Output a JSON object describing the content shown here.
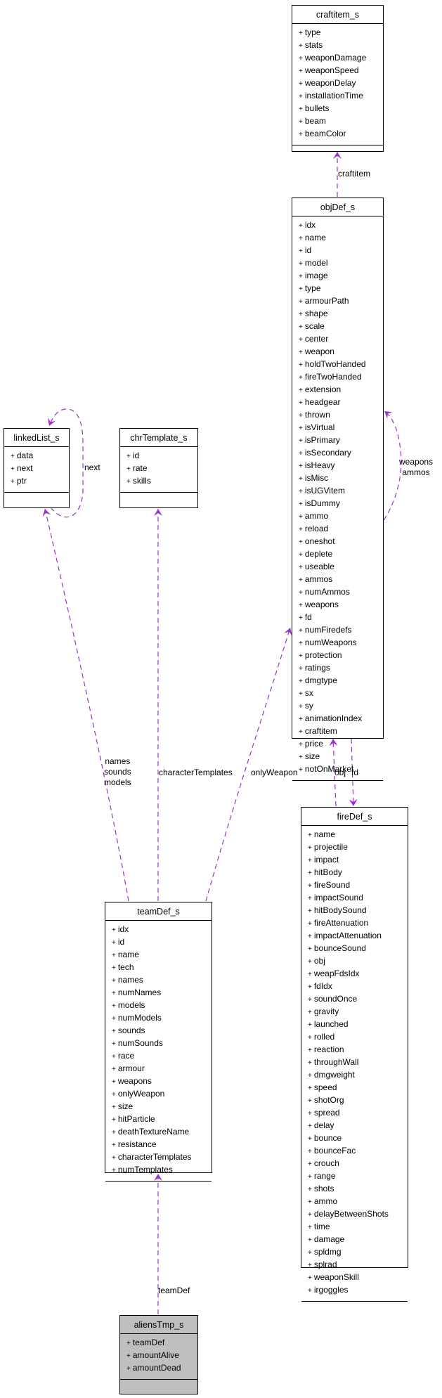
{
  "diagram": {
    "edge_color": "#9a32cd",
    "classes": [
      {
        "id": "craftitem_s",
        "name": "craftitem_s",
        "highlighted": false,
        "attributes": [
          "type",
          "stats",
          "weaponDamage",
          "weaponSpeed",
          "weaponDelay",
          "installationTime",
          "bullets",
          "beam",
          "beamColor"
        ]
      },
      {
        "id": "objDef_s",
        "name": "objDef_s",
        "highlighted": false,
        "attributes": [
          "idx",
          "name",
          "id",
          "model",
          "image",
          "type",
          "armourPath",
          "shape",
          "scale",
          "center",
          "weapon",
          "holdTwoHanded",
          "fireTwoHanded",
          "extension",
          "headgear",
          "thrown",
          "isVirtual",
          "isPrimary",
          "isSecondary",
          "isHeavy",
          "isMisc",
          "isUGVitem",
          "isDummy",
          "ammo",
          "reload",
          "oneshot",
          "deplete",
          "useable",
          "ammos",
          "numAmmos",
          "weapons",
          "fd",
          "numFiredefs",
          "numWeapons",
          "protection",
          "ratings",
          "dmgtype",
          "sx",
          "sy",
          "animationIndex",
          "craftitem",
          "price",
          "size",
          "notOnMarket"
        ]
      },
      {
        "id": "linkedList_s",
        "name": "linkedList_s",
        "highlighted": false,
        "attributes": [
          "data",
          "next",
          "ptr"
        ]
      },
      {
        "id": "chrTemplate_s",
        "name": "chrTemplate_s",
        "highlighted": false,
        "attributes": [
          "id",
          "rate",
          "skills"
        ]
      },
      {
        "id": "fireDef_s",
        "name": "fireDef_s",
        "highlighted": false,
        "attributes": [
          "name",
          "projectile",
          "impact",
          "hitBody",
          "fireSound",
          "impactSound",
          "hitBodySound",
          "fireAttenuation",
          "impactAttenuation",
          "bounceSound",
          "obj",
          "weapFdsIdx",
          "fdIdx",
          "soundOnce",
          "gravity",
          "launched",
          "rolled",
          "reaction",
          "throughWall",
          "dmgweight",
          "speed",
          "shotOrg",
          "spread",
          "delay",
          "bounce",
          "bounceFac",
          "crouch",
          "range",
          "shots",
          "ammo",
          "delayBetweenShots",
          "time",
          "damage",
          "spldmg",
          "splrad",
          "weaponSkill",
          "irgoggles"
        ]
      },
      {
        "id": "teamDef_s",
        "name": "teamDef_s",
        "highlighted": false,
        "attributes": [
          "idx",
          "id",
          "name",
          "tech",
          "names",
          "numNames",
          "models",
          "numModels",
          "sounds",
          "numSounds",
          "race",
          "armour",
          "weapons",
          "onlyWeapon",
          "size",
          "hitParticle",
          "deathTextureName",
          "resistance",
          "characterTemplates",
          "numTemplates"
        ]
      },
      {
        "id": "aliensTmp_s",
        "name": "aliensTmp_s",
        "highlighted": true,
        "attributes": [
          "teamDef",
          "amountAlive",
          "amountDead"
        ]
      }
    ],
    "edges": [
      {
        "from": "objDef_s",
        "to": "craftitem_s",
        "label": "craftitem"
      },
      {
        "from": "objDef_s",
        "to": "objDef_s",
        "label": "weapons\nammos"
      },
      {
        "from": "linkedList_s",
        "to": "linkedList_s",
        "label": "next"
      },
      {
        "from": "teamDef_s",
        "to": "linkedList_s",
        "label": "names\nsounds\nmodels"
      },
      {
        "from": "teamDef_s",
        "to": "chrTemplate_s",
        "label": "characterTemplates"
      },
      {
        "from": "teamDef_s",
        "to": "objDef_s",
        "label": "onlyWeapon"
      },
      {
        "from": "fireDef_s",
        "to": "objDef_s",
        "label": "obj"
      },
      {
        "from": "objDef_s",
        "to": "fireDef_s",
        "label": "fd"
      },
      {
        "from": "aliensTmp_s",
        "to": "teamDef_s",
        "label": "teamDef"
      }
    ]
  }
}
